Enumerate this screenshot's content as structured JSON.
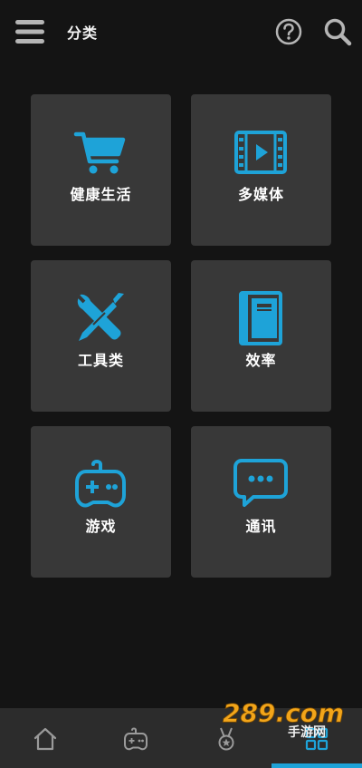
{
  "header": {
    "title": "分类",
    "menu_icon": "hamburger-menu-icon",
    "help_icon": "help-circle-icon",
    "search_icon": "search-icon"
  },
  "colors": {
    "background": "#141414",
    "tile": "#383838",
    "accent": "#1ea3d8",
    "nav_bar": "#2c2c2c",
    "icon_gray": "#b5b5b5",
    "text": "#ffffff"
  },
  "categories": [
    {
      "label": "健康生活",
      "icon": "shopping-cart-icon"
    },
    {
      "label": "多媒体",
      "icon": "video-film-icon"
    },
    {
      "label": "工具类",
      "icon": "tools-wrench-icon"
    },
    {
      "label": "效率",
      "icon": "notebook-icon"
    },
    {
      "label": "游戏",
      "icon": "gamepad-icon"
    },
    {
      "label": "通讯",
      "icon": "chat-bubble-icon"
    }
  ],
  "bottom_nav": {
    "items": [
      {
        "icon": "home-icon",
        "active": false
      },
      {
        "icon": "gamepad-icon",
        "active": false
      },
      {
        "icon": "medal-icon",
        "active": false
      },
      {
        "icon": "grid-icon",
        "active": true
      }
    ]
  },
  "watermark": {
    "text": "289.com",
    "subtext": "手游网"
  }
}
